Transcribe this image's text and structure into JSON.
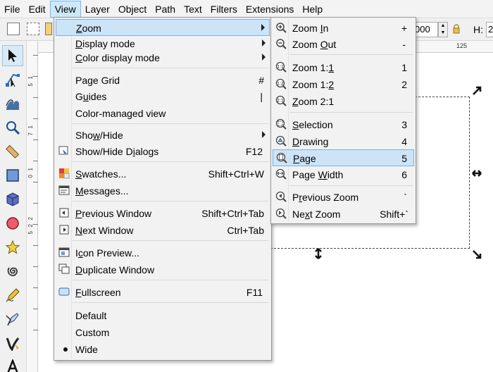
{
  "menubar": {
    "items": [
      "File",
      "Edit",
      "View",
      "Layer",
      "Object",
      "Path",
      "Text",
      "Filters",
      "Extensions",
      "Help"
    ],
    "active": "View"
  },
  "toolbar": {
    "field_value": "000",
    "h_label": "H:",
    "h_value": "2"
  },
  "hruler": {
    "label": "125"
  },
  "vruler": {
    "labels": [
      "1",
      "5",
      "1",
      "7",
      "1",
      "0",
      "2",
      "2",
      "5"
    ]
  },
  "view_menu": {
    "items": [
      {
        "label": "Zoom",
        "mnemonic": "Z",
        "submenu": true
      },
      {
        "label": "Display mode",
        "mnemonic": "D",
        "submenu": true
      },
      {
        "label": "Color display mode",
        "mnemonic": "C",
        "submenu": true
      },
      {
        "label": "Page Grid",
        "accel": "#"
      },
      {
        "label": "Guides",
        "mnemonic": "u",
        "accel": "|"
      },
      {
        "label": "Color-managed view"
      },
      {
        "label": "Show/Hide",
        "mnemonic": "w",
        "submenu": true
      },
      {
        "label": "Show/Hide Dialogs",
        "mnemonic": "i",
        "accel": "F12"
      },
      {
        "label": "Swatches...",
        "mnemonic": "S",
        "accel": "Shift+Ctrl+W"
      },
      {
        "label": "Messages...",
        "mnemonic": "M"
      },
      {
        "label": "Previous Window",
        "mnemonic": "P",
        "accel": "Shift+Ctrl+Tab"
      },
      {
        "label": "Next Window",
        "mnemonic": "N",
        "accel": "Ctrl+Tab"
      },
      {
        "label": "Icon Preview...",
        "mnemonic": "c"
      },
      {
        "label": "Duplicate Window",
        "mnemonic": "D"
      },
      {
        "label": "Fullscreen",
        "mnemonic": "F",
        "accel": "F11"
      },
      {
        "label": "Default"
      },
      {
        "label": "Custom"
      },
      {
        "label": "Wide",
        "checked": true
      }
    ]
  },
  "zoom_menu": {
    "items": [
      {
        "label": "Zoom In",
        "accel": "+",
        "icon": "zoom-in-icon"
      },
      {
        "label": "Zoom Out",
        "accel": "-",
        "icon": "zoom-out-icon"
      },
      {
        "label": "Zoom 1:1",
        "accel": "1",
        "icon": "zoom-1-1-icon"
      },
      {
        "label": "Zoom 1:2",
        "accel": "2",
        "icon": "zoom-1-2-icon"
      },
      {
        "label": "Zoom 2:1",
        "accel": "",
        "icon": "zoom-2-1-icon"
      },
      {
        "label": "Selection",
        "accel": "3",
        "icon": "zoom-selection-icon"
      },
      {
        "label": "Drawing",
        "accel": "4",
        "icon": "zoom-drawing-icon"
      },
      {
        "label": "Page",
        "accel": "5",
        "icon": "zoom-page-icon",
        "highlighted": true
      },
      {
        "label": "Page Width",
        "accel": "6",
        "icon": "zoom-page-width-icon"
      },
      {
        "label": "Previous Zoom",
        "accel": "`",
        "icon": "zoom-previous-icon"
      },
      {
        "label": "Next Zoom",
        "accel": "Shift+`",
        "icon": "zoom-next-icon"
      }
    ]
  }
}
